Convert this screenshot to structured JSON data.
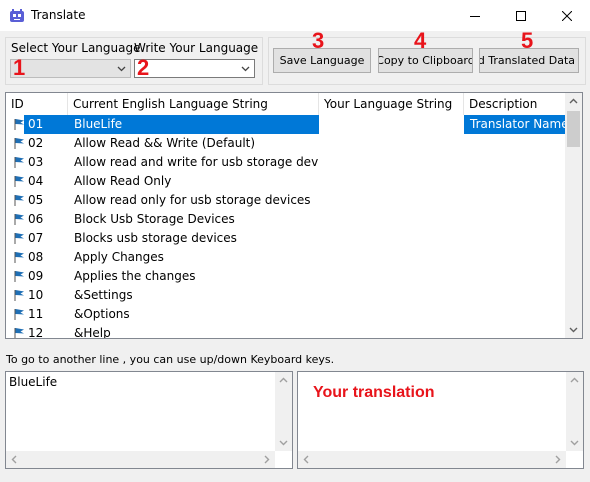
{
  "window": {
    "title": "Translate",
    "minimize_glyph": "—",
    "maximize_glyph": "☐",
    "close_glyph": "✕"
  },
  "selectors": {
    "select_language_label": "Select Your Language",
    "write_language_label": "Write Your Language",
    "select_language_value": "",
    "write_language_value": ""
  },
  "toolbar": {
    "save_label": "Save Language",
    "copy_label": "Copy to Clipboard",
    "send_label": "Send Translated Data"
  },
  "callouts": [
    "1",
    "2",
    "3",
    "4",
    "5"
  ],
  "list": {
    "columns": [
      "ID",
      "Current English Language String",
      "Your Language String",
      "Description"
    ],
    "rows": [
      {
        "id": "01",
        "english": "BlueLife",
        "yours": "",
        "description": "Translator Name",
        "selected": true
      },
      {
        "id": "02",
        "english": "Allow Read && Write (Default)",
        "yours": "",
        "description": ""
      },
      {
        "id": "03",
        "english": "Allow read and write for usb storage devices",
        "yours": "",
        "description": ""
      },
      {
        "id": "04",
        "english": "Allow Read Only",
        "yours": "",
        "description": ""
      },
      {
        "id": "05",
        "english": "Allow read only for usb storage devices",
        "yours": "",
        "description": ""
      },
      {
        "id": "06",
        "english": "Block Usb Storage Devices",
        "yours": "",
        "description": ""
      },
      {
        "id": "07",
        "english": "Blocks usb storage devices",
        "yours": "",
        "description": ""
      },
      {
        "id": "08",
        "english": "Apply Changes",
        "yours": "",
        "description": ""
      },
      {
        "id": "09",
        "english": "Applies the changes",
        "yours": "",
        "description": ""
      },
      {
        "id": "10",
        "english": "&Settings",
        "yours": "",
        "description": ""
      },
      {
        "id": "11",
        "english": "&Options",
        "yours": "",
        "description": ""
      },
      {
        "id": "12",
        "english": "&Help",
        "yours": "",
        "description": ""
      }
    ]
  },
  "hint": "To go to another line , you can use up/down Keyboard keys.",
  "source_text": "BlueLife",
  "translation_placeholder": "Your translation",
  "colors": {
    "selection": "#0078d7",
    "callout": "#e8141b",
    "flag": "#1f6fb5"
  }
}
